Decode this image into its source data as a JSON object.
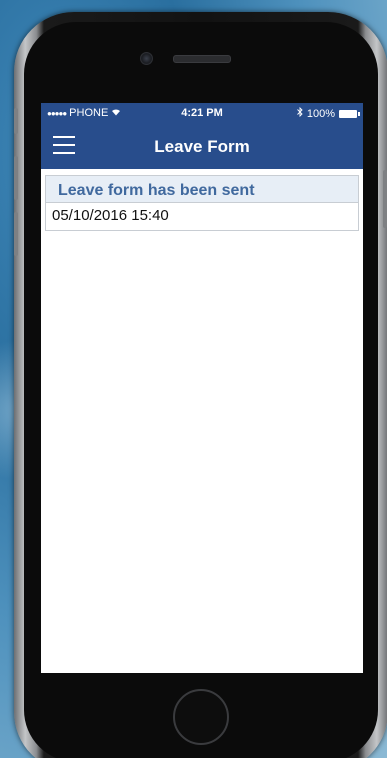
{
  "status_bar": {
    "carrier": "PHONE",
    "signal_dots": "●●●●●",
    "time": "4:21 PM",
    "battery": "100%",
    "icons": [
      "wifi-icon",
      "bluetooth-icon",
      "battery-icon"
    ]
  },
  "nav": {
    "title": "Leave Form",
    "menu_icon": "hamburger-menu-icon"
  },
  "card": {
    "header": "Leave form has been sent",
    "timestamp": "05/10/2016 15:40"
  },
  "colors": {
    "nav_bar": "#284d8c",
    "card_header_bg": "#e7eef6",
    "card_header_text": "#40699e"
  }
}
